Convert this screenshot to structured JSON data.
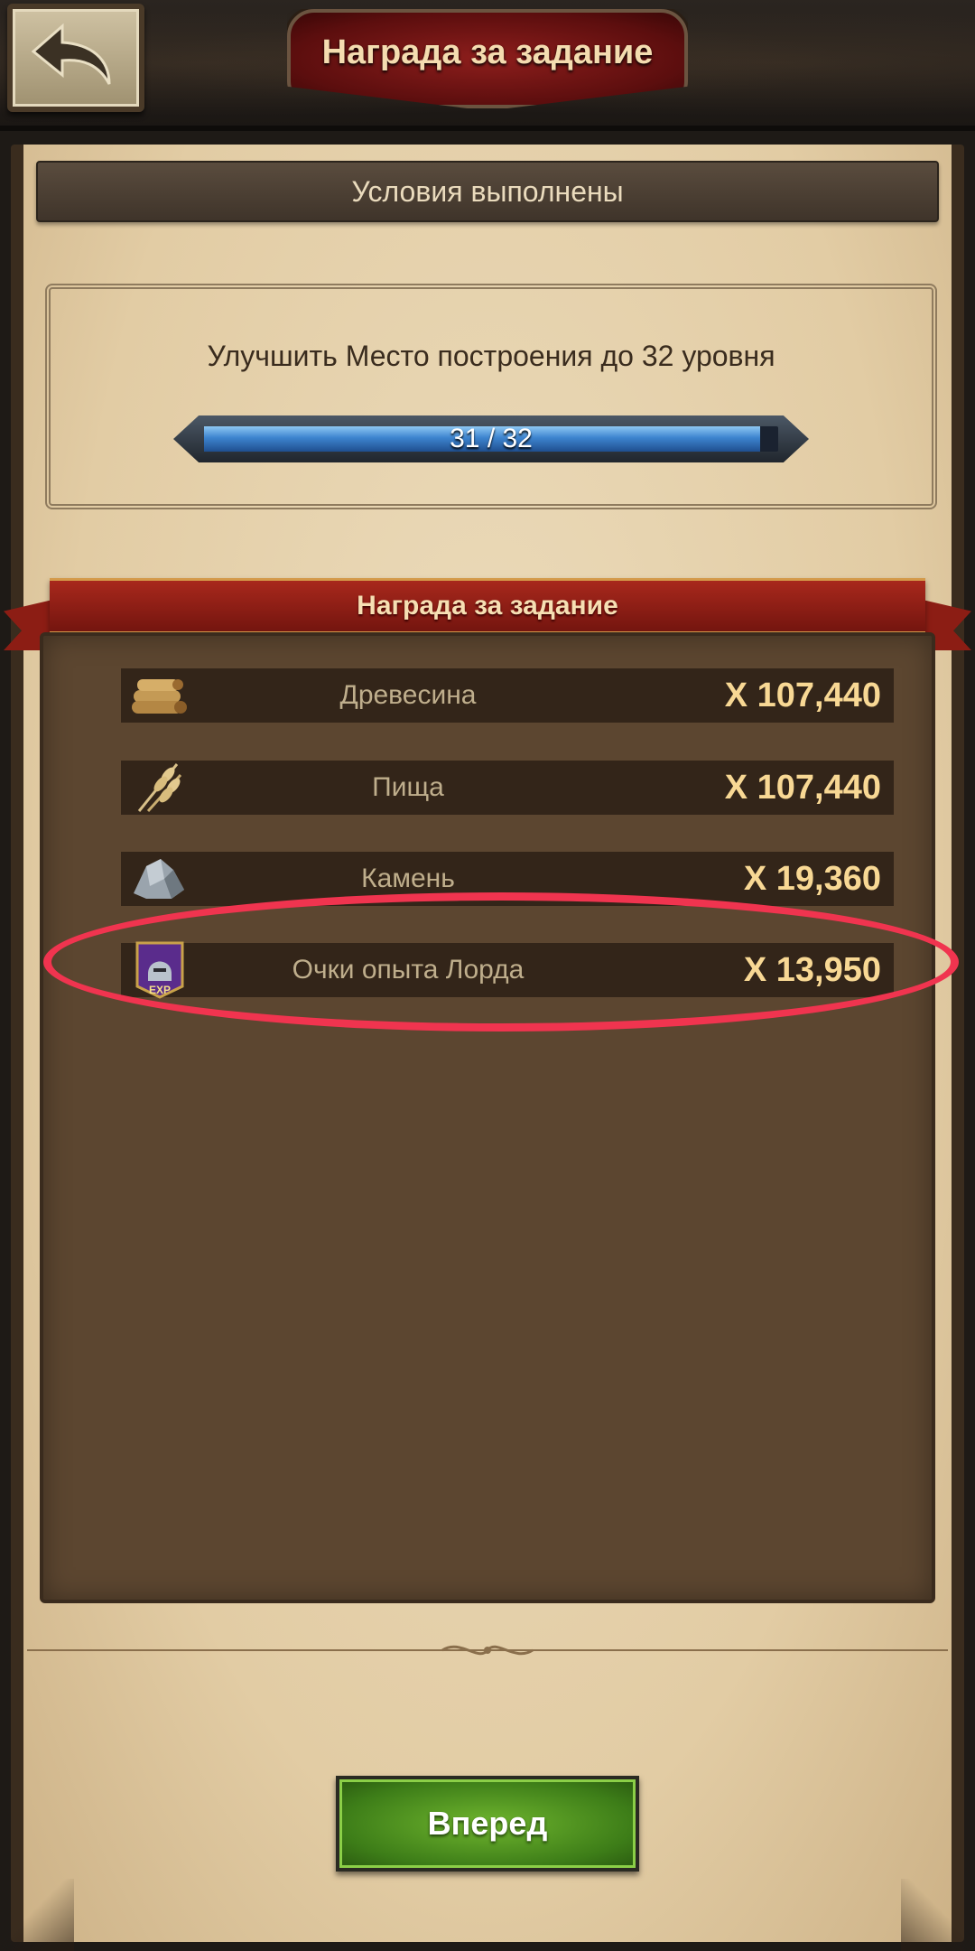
{
  "header": {
    "title": "Награда за задание",
    "back_icon": "back-arrow-icon"
  },
  "conditions": {
    "status": "Условия выполнены"
  },
  "task": {
    "description": "Улучшить  Место построения  до 32 уровня",
    "progress": {
      "current": 31,
      "target": 32,
      "label": "31 / 32"
    }
  },
  "rewards": {
    "title": "Награда за задание",
    "items": [
      {
        "icon": "wood-icon",
        "name": "Древесина",
        "amount": "X 107,440"
      },
      {
        "icon": "food-wheat-icon",
        "name": "Пища",
        "amount": "X 107,440"
      },
      {
        "icon": "stone-icon",
        "name": "Камень",
        "amount": "X 19,360"
      },
      {
        "icon": "lord-exp-icon",
        "name": "Очки опыта Лорда",
        "amount": "X 13,950",
        "icon_text": "EXP"
      }
    ]
  },
  "forward_button": {
    "label": "Вперед"
  },
  "colors": {
    "highlight": "#f0344f",
    "accent_gold": "#f8d894",
    "button_green": "#3d7d18"
  }
}
